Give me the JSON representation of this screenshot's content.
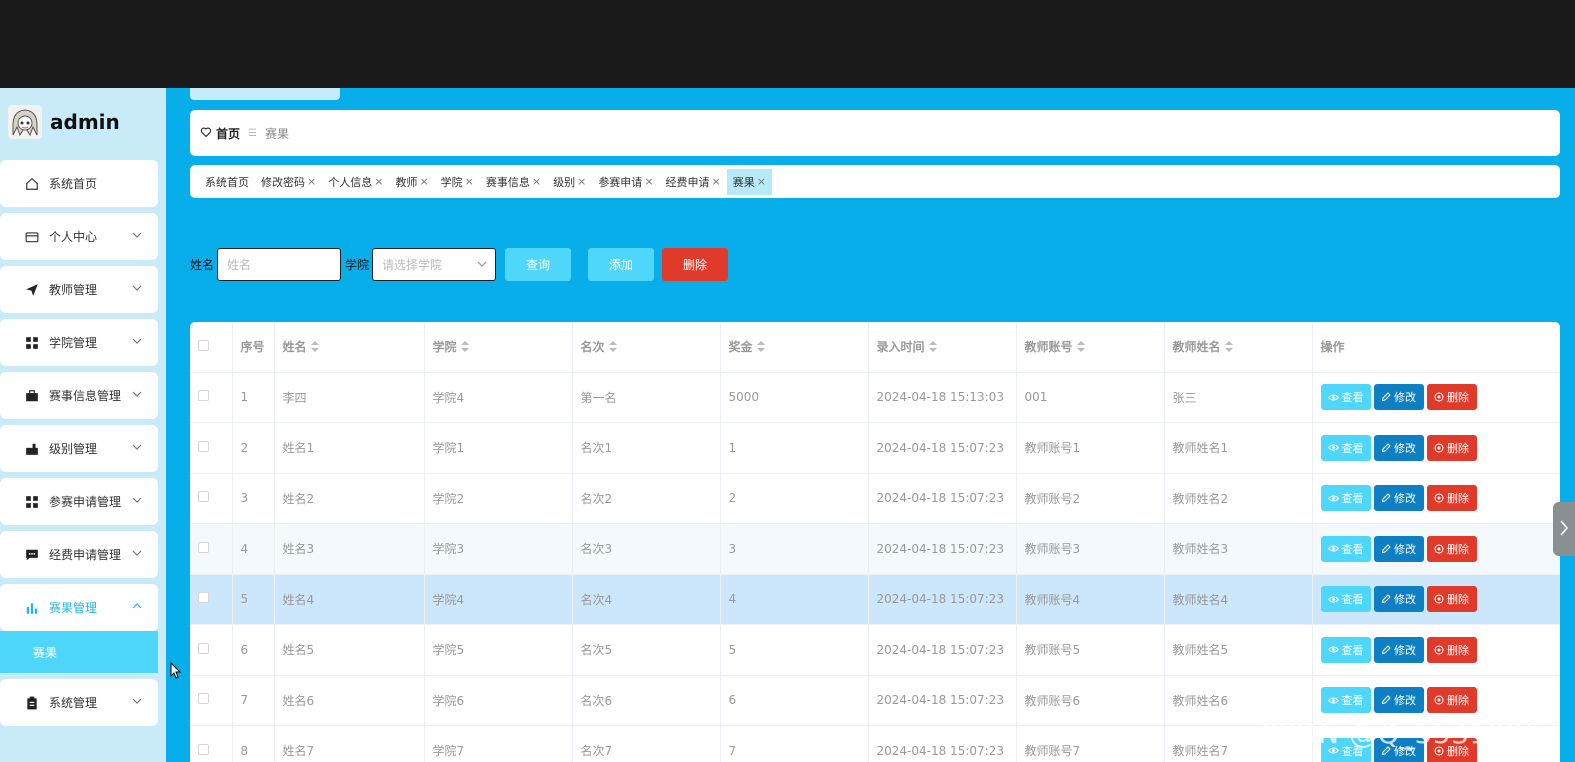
{
  "user": {
    "name": "admin"
  },
  "sidebar": {
    "items": [
      {
        "label": "系统首页",
        "icon": "home-icon",
        "has_arrow": false
      },
      {
        "label": "个人中心",
        "icon": "wallet-icon",
        "has_arrow": true
      },
      {
        "label": "教师管理",
        "icon": "send-icon",
        "has_arrow": true
      },
      {
        "label": "学院管理",
        "icon": "grid-icon",
        "has_arrow": true
      },
      {
        "label": "赛事信息管理",
        "icon": "briefcase-icon",
        "has_arrow": true
      },
      {
        "label": "级别管理",
        "icon": "chart-box-icon",
        "has_arrow": true
      },
      {
        "label": "参赛申请管理",
        "icon": "grid-icon",
        "has_arrow": true
      },
      {
        "label": "经费申请管理",
        "icon": "chat-icon",
        "has_arrow": true
      },
      {
        "label": "赛果管理",
        "icon": "bar-chart-icon",
        "has_arrow": true,
        "active": true
      },
      {
        "label": "系统管理",
        "icon": "clipboard-icon",
        "has_arrow": true
      }
    ],
    "submenu_label": "赛果"
  },
  "breadcrumb": {
    "home": "首页",
    "sep": "☰",
    "current": "赛果"
  },
  "tags": [
    {
      "label": "系统首页",
      "closable": false
    },
    {
      "label": "修改密码",
      "closable": true
    },
    {
      "label": "个人信息",
      "closable": true
    },
    {
      "label": "教师",
      "closable": true
    },
    {
      "label": "学院",
      "closable": true
    },
    {
      "label": "赛事信息",
      "closable": true
    },
    {
      "label": "级别",
      "closable": true
    },
    {
      "label": "参赛申请",
      "closable": true
    },
    {
      "label": "经费申请",
      "closable": true
    },
    {
      "label": "赛果",
      "closable": true,
      "active": true
    }
  ],
  "search": {
    "name_label": "姓名",
    "name_placeholder": "姓名",
    "college_label": "学院",
    "college_placeholder": "请选择学院",
    "query_btn": "查询",
    "add_btn": "添加",
    "delete_btn": "删除"
  },
  "table": {
    "columns": [
      "序号",
      "姓名",
      "学院",
      "名次",
      "奖金",
      "录入时间",
      "教师账号",
      "教师姓名",
      "操作"
    ],
    "op_labels": {
      "view": "查看",
      "edit": "修改",
      "delete": "删除"
    },
    "rows": [
      [
        "1",
        "李四",
        "学院4",
        "第一名",
        "5000",
        "2024-04-18 15:13:03",
        "001",
        "张三"
      ],
      [
        "2",
        "姓名1",
        "学院1",
        "名次1",
        "1",
        "2024-04-18 15:07:23",
        "教师账号1",
        "教师姓名1"
      ],
      [
        "3",
        "姓名2",
        "学院2",
        "名次2",
        "2",
        "2024-04-18 15:07:23",
        "教师账号2",
        "教师姓名2"
      ],
      [
        "4",
        "姓名3",
        "学院3",
        "名次3",
        "3",
        "2024-04-18 15:07:23",
        "教师账号3",
        "教师姓名3"
      ],
      [
        "5",
        "姓名4",
        "学院4",
        "名次4",
        "4",
        "2024-04-18 15:07:23",
        "教师账号4",
        "教师姓名4"
      ],
      [
        "6",
        "姓名5",
        "学院5",
        "名次5",
        "5",
        "2024-04-18 15:07:23",
        "教师账号5",
        "教师姓名5"
      ],
      [
        "7",
        "姓名6",
        "学院6",
        "名次6",
        "6",
        "2024-04-18 15:07:23",
        "教师账号6",
        "教师姓名6"
      ],
      [
        "8",
        "姓名7",
        "学院7",
        "名次7",
        "7",
        "2024-04-18 15:07:23",
        "教师账号7",
        "教师姓名7"
      ]
    ],
    "striped_row_index": 3,
    "selected_row_index": 4
  },
  "watermark": "CSDN @Q_55318293",
  "colors": {
    "main_bg": "#08aeea",
    "sidebar_bg": "#c9ebf8",
    "accent": "#4ed6fb",
    "edit": "#0e7fc2",
    "danger": "#e03a2a"
  }
}
